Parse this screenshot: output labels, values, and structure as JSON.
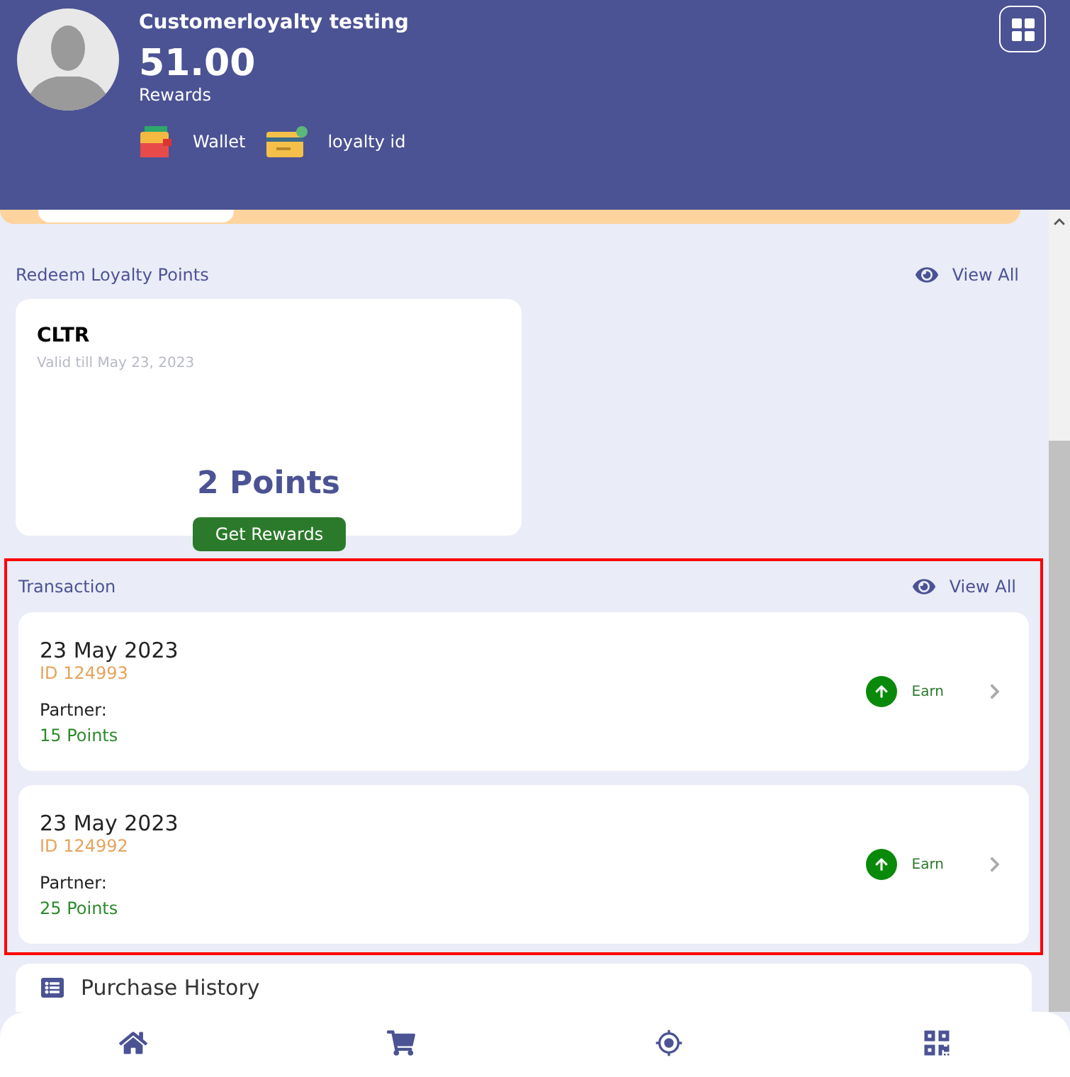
{
  "profile": {
    "name": "Customerloyalty testing",
    "balance": "51.00",
    "balance_label": "Rewards",
    "links": [
      {
        "kind": "wallet",
        "label": "Wallet"
      },
      {
        "kind": "card",
        "label": "loyalty id"
      }
    ]
  },
  "redeem": {
    "title": "Redeem Loyalty Points",
    "view_all": "View All",
    "offers": [
      {
        "code": "CLTR",
        "valid": "Valid till May 23, 2023",
        "points": "2 Points",
        "action": "Get Rewards"
      }
    ]
  },
  "transactions": {
    "title": "Transaction",
    "view_all": "View All",
    "highlighted": true,
    "items": [
      {
        "date": "23 May 2023",
        "id": "ID 124993",
        "partner_label": "Partner:",
        "points": "15 Points",
        "type": "Earn"
      },
      {
        "date": "23 May 2023",
        "id": "ID 124992",
        "partner_label": "Partner:",
        "points": "25 Points",
        "type": "Earn"
      }
    ]
  },
  "purchase_history": {
    "title": "Purchase History"
  },
  "nav": [
    {
      "kind": "home"
    },
    {
      "kind": "cart"
    },
    {
      "kind": "locate"
    },
    {
      "kind": "qr"
    }
  ]
}
